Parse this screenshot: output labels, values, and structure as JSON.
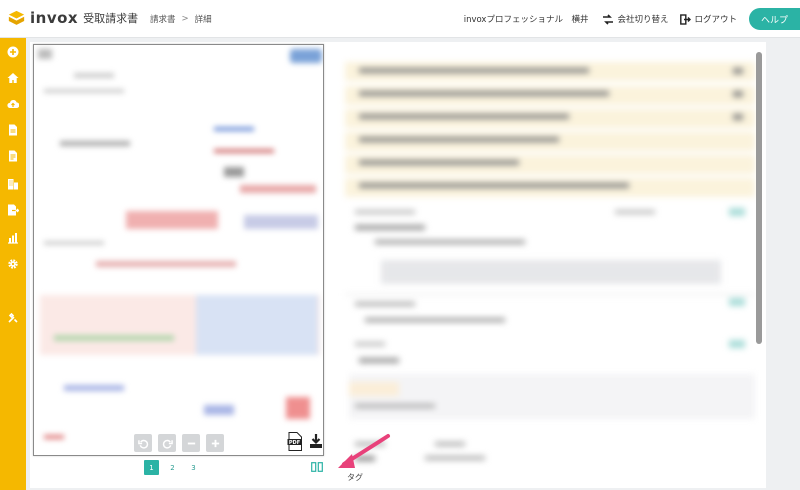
{
  "app": {
    "brand": "invox",
    "subtitle": "受取請求書",
    "accent": "#2bb3a5",
    "sidebar_color": "#f5b800"
  },
  "breadcrumb": {
    "items": [
      "請求書",
      "詳細"
    ],
    "separator": ">"
  },
  "header": {
    "user_label": "invoxプロフェッショナル　横井",
    "switch_company": "会社切り替え",
    "logout": "ログアウト",
    "help": "ヘルプ"
  },
  "sidebar": {
    "icons": [
      "plus-circle-icon",
      "home-icon",
      "cloud-upload-icon",
      "document-icon",
      "document-alt-icon",
      "building-icon",
      "export-icon",
      "chart-icon",
      "gear-icon",
      "tools-icon"
    ]
  },
  "viewer": {
    "toolbar_icons": [
      "rotate-left-icon",
      "rotate-right-icon",
      "zoom-out-icon",
      "zoom-in-icon",
      "pdf-icon",
      "download-icon"
    ],
    "pages": [
      "1",
      "2",
      "3"
    ],
    "current_page": "1"
  },
  "detail": {
    "tag_label": "タグ"
  }
}
